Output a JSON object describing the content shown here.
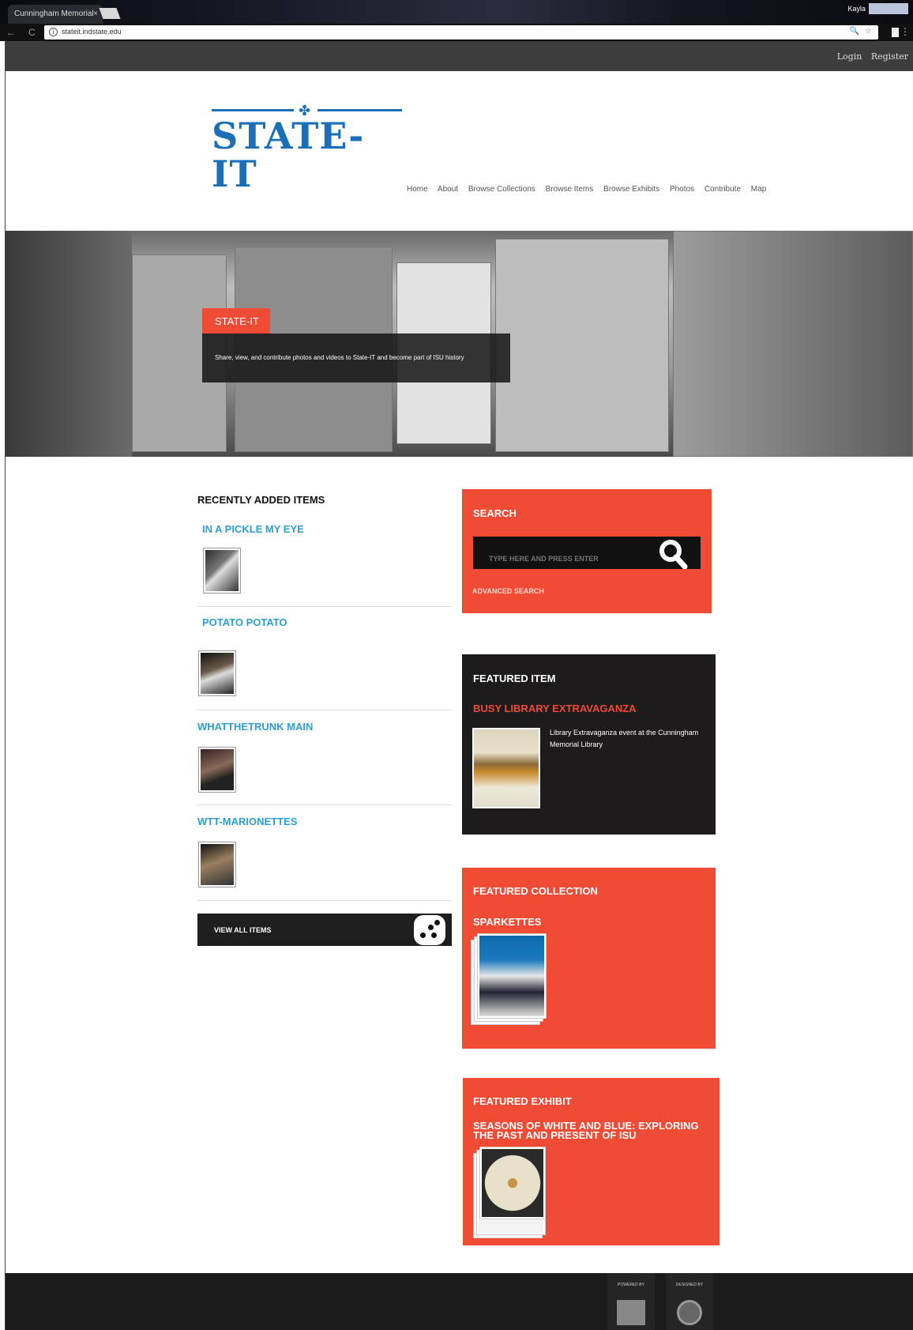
{
  "browser": {
    "tab_title": "Cunningham Memorial",
    "tab_close": "×",
    "user_name": "Kayla",
    "url": "stateit.indstate.edu",
    "back": "←",
    "reload": "C",
    "info_glyph": "i",
    "zoom_glyph": "🔍",
    "star_glyph": "☆",
    "menu_glyph": "⋮"
  },
  "topbar": {
    "login": "Login",
    "register": "Register"
  },
  "logo": {
    "text": "STATE-IT",
    "leaf_glyph": "✤",
    "color": "#1b6fb8"
  },
  "nav": {
    "items": [
      "Home",
      "About",
      "Browse Collections",
      "Browse Items",
      "Browse Exhibits",
      "Photos",
      "Contribute",
      "Map"
    ]
  },
  "hero": {
    "title": "STATE-IT",
    "description": "Share, view, and contribute photos and videos to State-IT and become part of ISU history"
  },
  "recent": {
    "heading": "RECENTLY ADDED ITEMS",
    "items": [
      {
        "title": "IN A PICKLE MY EYE"
      },
      {
        "title": "POTATO POTATO"
      },
      {
        "title": "WHATTHETRUNK MAIN"
      },
      {
        "title": "WTT-MARIONETTES"
      }
    ],
    "view_all": "VIEW ALL ITEMS"
  },
  "search": {
    "heading": "SEARCH",
    "placeholder": "TYPE HERE AND PRESS ENTER",
    "advanced": "ADVANCED SEARCH"
  },
  "featured_item": {
    "heading": "FEATURED ITEM",
    "title": "BUSY LIBRARY EXTRAVAGANZA",
    "description": "Library Extravaganza event at the Cunningham Memorial Library"
  },
  "featured_collection": {
    "heading": "FEATURED COLLECTION",
    "title": "SPARKETTES"
  },
  "featured_exhibit": {
    "heading": "FEATURED EXHIBIT",
    "title": "SEASONS OF WHITE AND BLUE: EXPLORING THE PAST AND PRESENT OF ISU"
  },
  "footer": {
    "powered_by": "POWERED BY",
    "designed_by": "DESIGNED BY"
  },
  "colors": {
    "accent": "#f04b35",
    "link_blue": "#2c9fd0",
    "dark": "#1d1b1c"
  }
}
